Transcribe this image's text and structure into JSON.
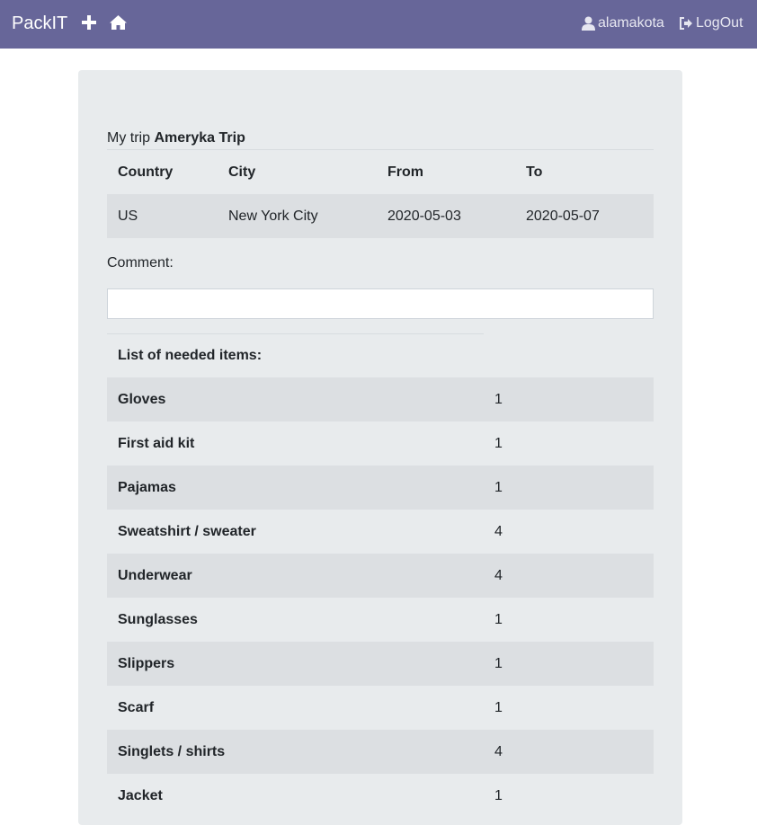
{
  "navbar": {
    "brand": "PackIT",
    "user": "alamakota",
    "logout": "LogOut"
  },
  "trip": {
    "prefix": "My trip",
    "name": "Ameryka Trip",
    "headers": [
      "Country",
      "City",
      "From",
      "To"
    ],
    "values": [
      "US",
      "New York City",
      "2020-05-03",
      "2020-05-07"
    ]
  },
  "comment": {
    "label": "Comment:",
    "value": ""
  },
  "items": {
    "heading": "List of needed items:",
    "list": [
      {
        "name": "Gloves",
        "qty": "1"
      },
      {
        "name": "First aid kit",
        "qty": "1"
      },
      {
        "name": "Pajamas",
        "qty": "1"
      },
      {
        "name": "Sweatshirt / sweater",
        "qty": "4"
      },
      {
        "name": "Underwear",
        "qty": "4"
      },
      {
        "name": "Sunglasses",
        "qty": "1"
      },
      {
        "name": "Slippers",
        "qty": "1"
      },
      {
        "name": "Scarf",
        "qty": "1"
      },
      {
        "name": "Singlets / shirts",
        "qty": "4"
      },
      {
        "name": "Jacket",
        "qty": "1"
      }
    ]
  }
}
